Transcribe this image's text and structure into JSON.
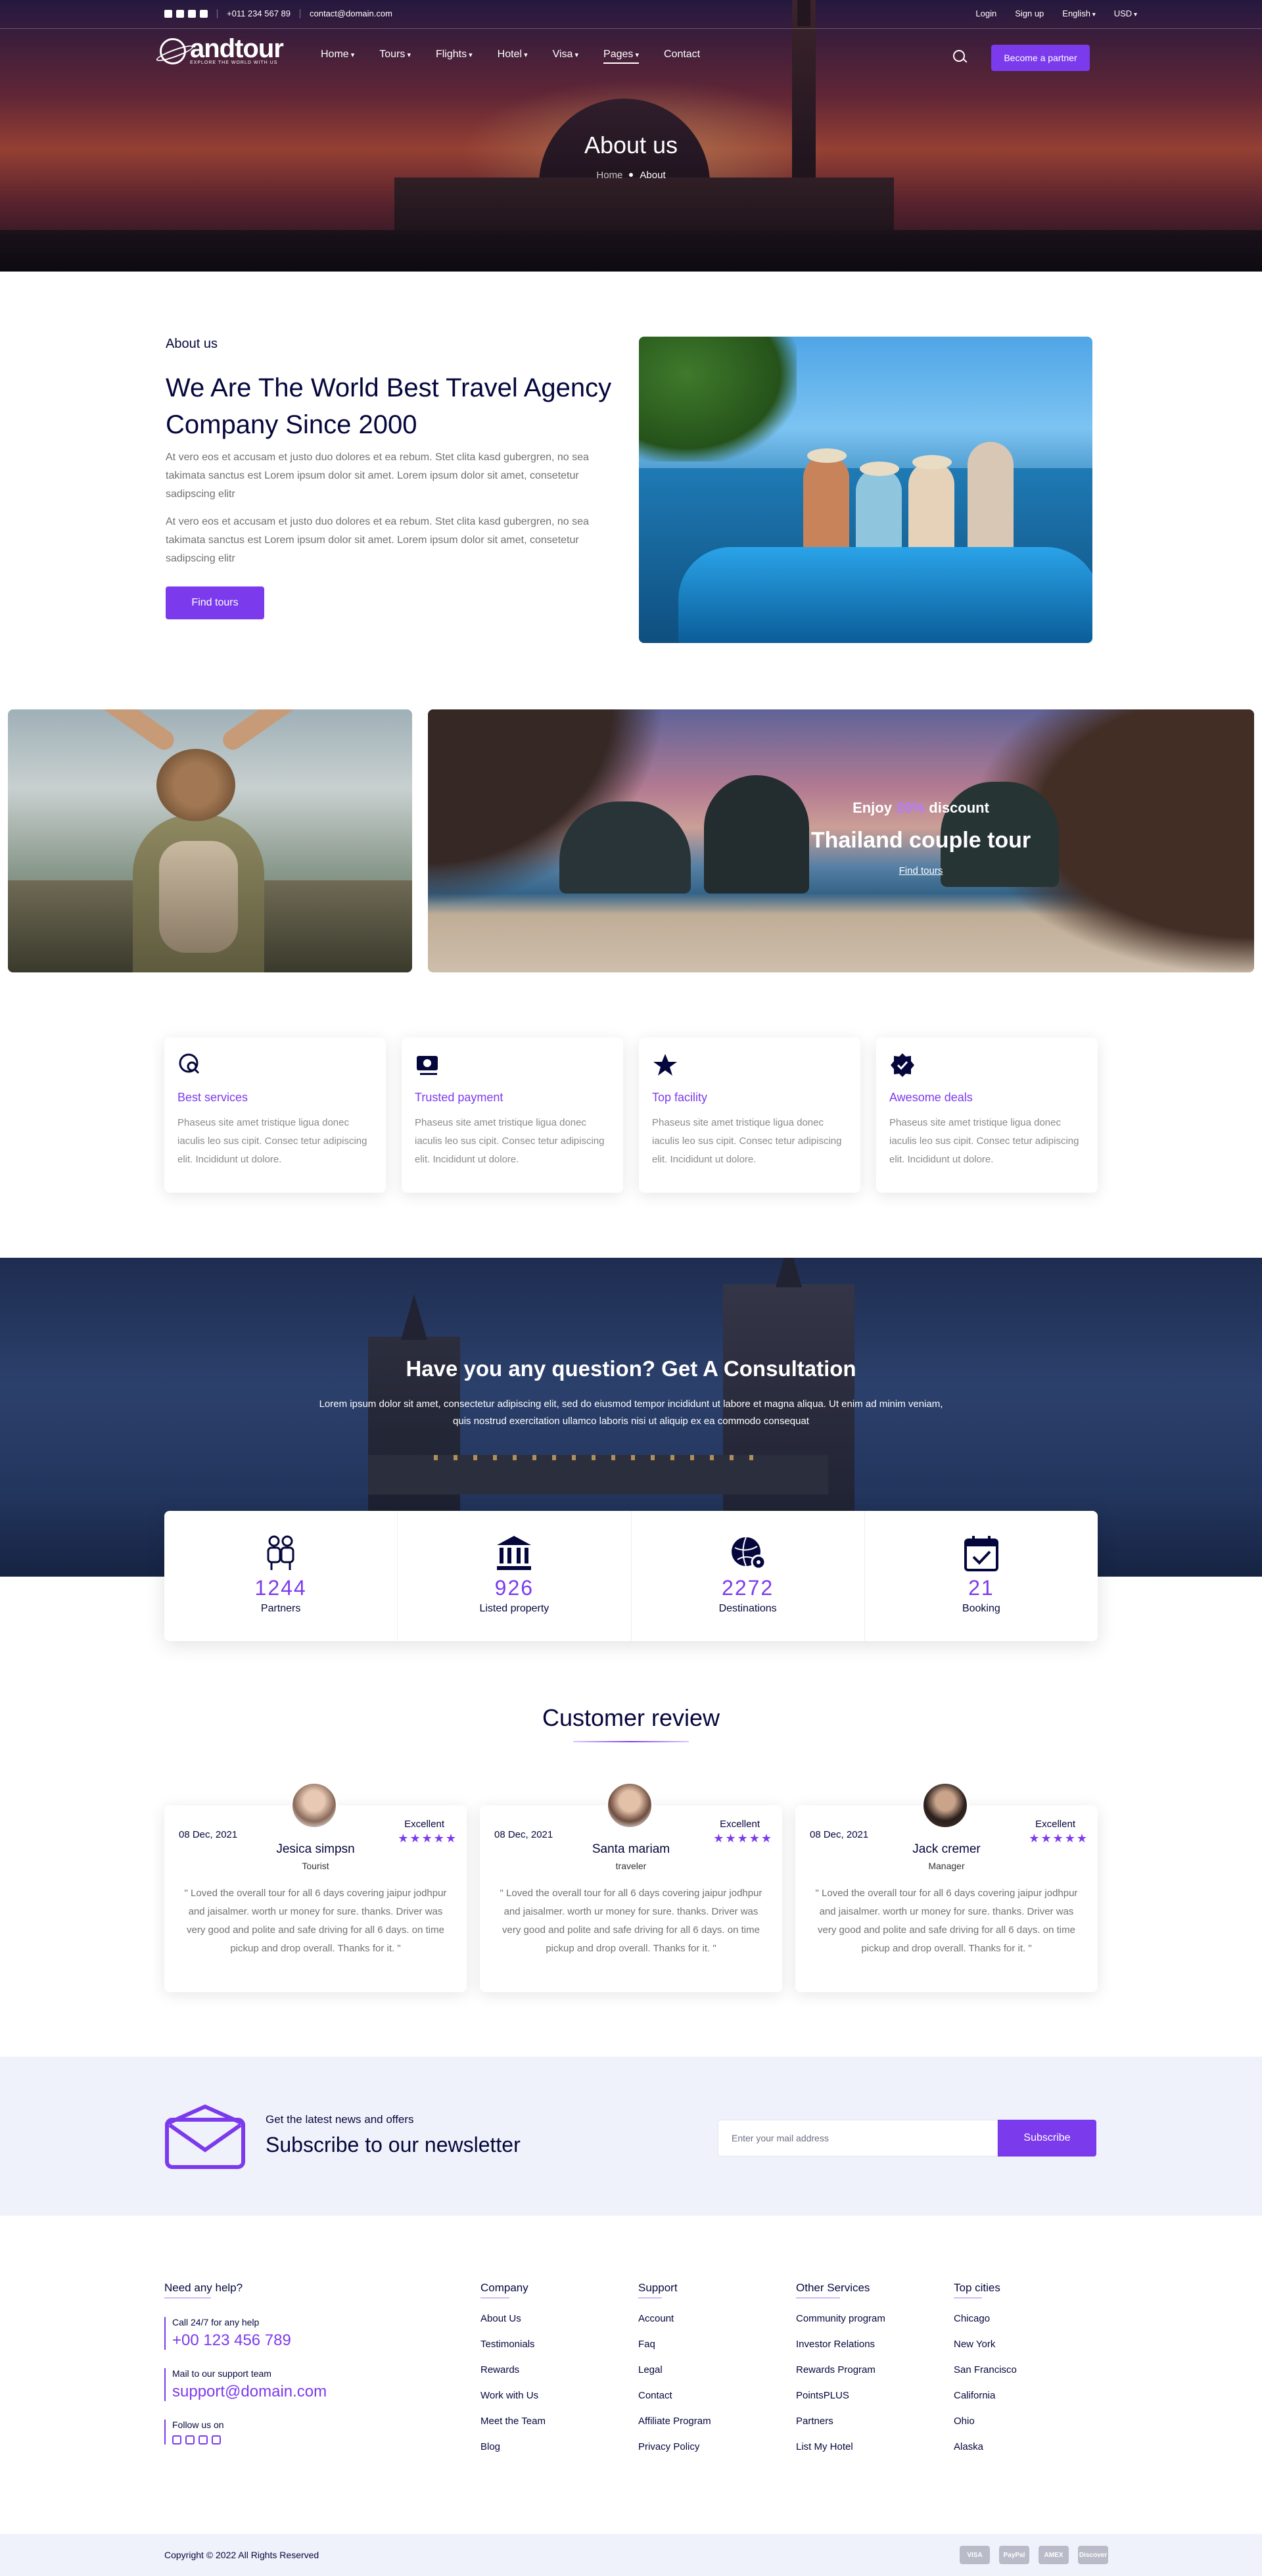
{
  "topbar": {
    "phone": "+011 234 567 89",
    "email": "contact@domain.com",
    "login": "Login",
    "signup": "Sign up",
    "language": "English",
    "currency": "USD"
  },
  "nav": {
    "brand": "andtour",
    "tagline": "EXPLORE THE WORLD WITH US",
    "menu": [
      "Home",
      "Tours",
      "Flights",
      "Hotel",
      "Visa",
      "Pages",
      "Contact"
    ],
    "partner_label": "Become a partner"
  },
  "hero": {
    "title": "About us",
    "breadcrumb_home": "Home",
    "breadcrumb_current": "About"
  },
  "about": {
    "eyebrow": "About us",
    "heading": "We Are The World Best Travel Agency Company Since 2000",
    "paragraphs": [
      "At vero eos et accusam et justo duo dolores et ea rebum. Stet clita kasd gubergren, no sea takimata sanctus est Lorem ipsum dolor sit amet. Lorem ipsum dolor sit amet, consetetur sadipscing elitr",
      "At vero eos et accusam et justo duo dolores et ea rebum. Stet clita kasd gubergren, no sea takimata sanctus est Lorem ipsum dolor sit amet. Lorem ipsum dolor sit amet, consetetur sadipscing elitr"
    ],
    "button_label": "Find tours"
  },
  "promo": {
    "enjoy_prefix": "Enjoy",
    "discount": "20%",
    "enjoy_suffix": "discount",
    "title": "Thailand couple tour",
    "link_label": "Find tours"
  },
  "features": [
    {
      "icon": "search-globe-icon",
      "title": "Best services",
      "desc": "Phaseus site amet tristique ligua donec iaculis leo sus cipit. Consec tetur adipiscing elit. Incididunt ut dolore."
    },
    {
      "icon": "payment-icon",
      "title": "Trusted payment",
      "desc": "Phaseus site amet tristique ligua donec iaculis leo sus cipit. Consec tetur adipiscing elit. Incididunt ut dolore."
    },
    {
      "icon": "star-icon",
      "title": "Top facility",
      "desc": "Phaseus site amet tristique ligua donec iaculis leo sus cipit. Consec tetur adipiscing elit. Incididunt ut dolore."
    },
    {
      "icon": "verified-badge-icon",
      "title": "Awesome deals",
      "desc": "Phaseus site amet tristique ligua donec iaculis leo sus cipit. Consec tetur adipiscing elit. Incididunt ut dolore."
    }
  ],
  "consult": {
    "title": "Have you any question? Get A Consultation",
    "text": "Lorem ipsum dolor sit amet, consectetur adipiscing elit, sed do eiusmod tempor incididunt ut labore et magna aliqua. Ut enim ad minim veniam, quis nostrud exercitation ullamco laboris nisi ut aliquip ex ea commodo consequat"
  },
  "stats": [
    {
      "icon": "partners-icon",
      "value": "1244",
      "label": "Partners"
    },
    {
      "icon": "bank-icon",
      "value": "926",
      "label": "Listed property"
    },
    {
      "icon": "globe-pin-icon",
      "value": "2272",
      "label": "Destinations"
    },
    {
      "icon": "calendar-check-icon",
      "value": "21",
      "label": "Booking"
    }
  ],
  "reviews": {
    "title": "Customer review",
    "items": [
      {
        "date": "08 Dec, 2021",
        "rating_label": "Excellent",
        "stars": 5,
        "name": "Jesica simpsn",
        "role": "Tourist",
        "text": "\" Loved the overall tour for all 6 days covering jaipur jodhpur and jaisalmer. worth ur money for sure. thanks. Driver was very good and polite and safe driving for all 6 days. on time pickup and drop overall. Thanks for it. \""
      },
      {
        "date": "08 Dec, 2021",
        "rating_label": "Excellent",
        "stars": 5,
        "name": "Santa mariam",
        "role": "traveler",
        "text": "\" Loved the overall tour for all 6 days covering jaipur jodhpur and jaisalmer. worth ur money for sure. thanks. Driver was very good and polite and safe driving for all 6 days. on time pickup and drop overall. Thanks for it. \""
      },
      {
        "date": "08 Dec, 2021",
        "rating_label": "Excellent",
        "stars": 5,
        "name": "Jack cremer",
        "role": "Manager",
        "text": "\" Loved the overall tour for all 6 days covering jaipur jodhpur and jaisalmer. worth ur money for sure. thanks. Driver was very good and polite and safe driving for all 6 days. on time pickup and drop overall. Thanks for it. \""
      }
    ]
  },
  "newsletter": {
    "kicker": "Get the latest news and offers",
    "headline": "Subscribe to our newsletter",
    "placeholder": "Enter your mail address",
    "button_label": "Subscribe"
  },
  "footer": {
    "help_title": "Need any help?",
    "call_label": "Call 24/7 for any help",
    "phone": "+00 123 456 789",
    "mail_label": "Mail to our support team",
    "mail": "support@domain.com",
    "follow_label": "Follow us on",
    "columns": [
      {
        "title": "Company",
        "links": [
          "About Us",
          "Testimonials",
          "Rewards",
          "Work with Us",
          "Meet the Team",
          "Blog"
        ]
      },
      {
        "title": "Support",
        "links": [
          "Account",
          "Faq",
          "Legal",
          "Contact",
          "Affiliate Program",
          "Privacy Policy"
        ]
      },
      {
        "title": "Other Services",
        "links": [
          "Community program",
          "Investor Relations",
          "Rewards Program",
          "PointsPLUS",
          "Partners",
          "List My Hotel"
        ]
      },
      {
        "title": "Top cities",
        "links": [
          "Chicago",
          "New York",
          "San Francisco",
          "California",
          "Ohio",
          "Alaska"
        ]
      }
    ],
    "copyright": "Copyright © 2022 All Rights Reserved",
    "payments": [
      "VISA",
      "PayPal",
      "AMEX",
      "Discover"
    ]
  },
  "colors": {
    "accent": "#7c3aed",
    "text_dark": "#05073c",
    "muted": "#717171",
    "light_bg": "#f0f2fb"
  }
}
